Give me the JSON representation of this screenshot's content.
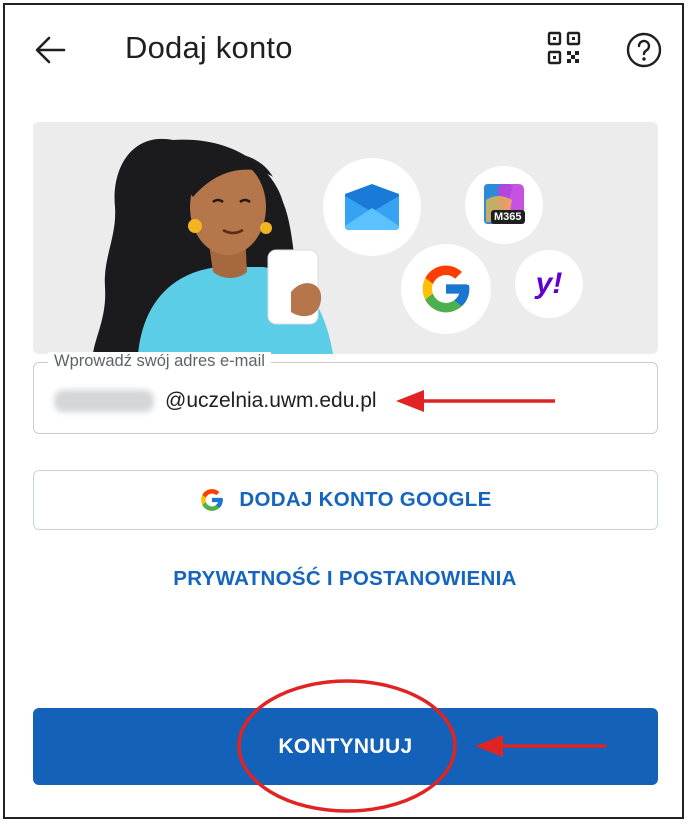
{
  "header": {
    "title": "Dodaj konto",
    "back_icon": "arrow-left-icon",
    "qr_icon": "qr-code-icon",
    "help_icon": "help-circle-icon"
  },
  "hero": {
    "apps": [
      {
        "name": "outlook-icon",
        "label": ""
      },
      {
        "name": "microsoft-365-icon",
        "label": "M365"
      },
      {
        "name": "google-icon",
        "label": ""
      },
      {
        "name": "yahoo-icon",
        "label": "y!"
      }
    ]
  },
  "email": {
    "label": "Wprowadź swój adres e-mail",
    "value": "@uczelnia.uwm.edu.pl"
  },
  "google_button": {
    "label": "DODAJ KONTO GOOGLE",
    "icon": "google-icon"
  },
  "privacy_link": "PRYWATNOŚĆ I POSTANOWIENIA",
  "continue_button": "KONTYNUUJ",
  "colors": {
    "accent": "#1361b8",
    "link": "#1565c0",
    "annotation": "#e02424"
  }
}
